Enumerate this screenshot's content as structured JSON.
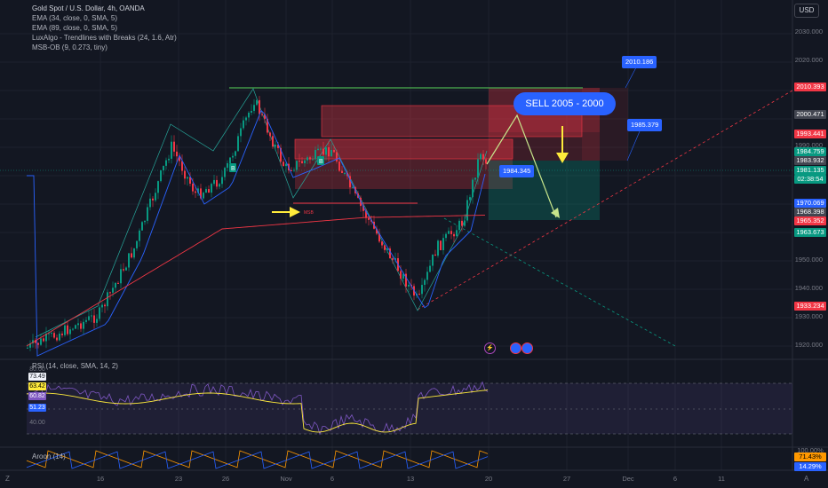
{
  "legend": {
    "title": "Gold Spot / U.S. Dollar, 4h, OANDA",
    "lines": [
      "EMA (34, close, 0, SMA, 5)",
      "EMA (89, close, 0, SMA, 5)",
      "LuxAlgo - Trendlines with Breaks (24, 1.6, Atr)",
      "MSB-OB (9, 0.273, tiny)"
    ]
  },
  "currency_button": "USD",
  "price_axis": {
    "labels": [
      "2030.000",
      "2020.000",
      "1990.000",
      "1950.000",
      "1940.000",
      "1930.000",
      "1920.000"
    ],
    "tags": [
      {
        "text": "2010.393",
        "color": "#f23645"
      },
      {
        "text": "2000.471",
        "color": "#434651"
      },
      {
        "text": "1993.441",
        "color": "#f23645"
      },
      {
        "text": "1984.759",
        "color": "#089981"
      },
      {
        "text": "1983.932",
        "color": "#434651"
      },
      {
        "text": "1981.135",
        "color": "#089981"
      },
      {
        "text": "02:38:54",
        "color": "#089981"
      },
      {
        "text": "1970.069",
        "color": "#2962ff"
      },
      {
        "text": "1968.398",
        "color": "#434651"
      },
      {
        "text": "1965.352",
        "color": "#f23645"
      },
      {
        "text": "1963.673",
        "color": "#089981"
      },
      {
        "text": "1933.234",
        "color": "#f23645"
      }
    ]
  },
  "annotations": {
    "sell_text": "SELL 2005 - 2000",
    "callouts": [
      "2010.186",
      "1985.379",
      "1984.345"
    ],
    "markers": [
      "B",
      "B",
      "MSB"
    ]
  },
  "rsi": {
    "label": "RSI (14, close, SMA, 14, 2)",
    "tags": [
      {
        "text": "73.49",
        "color": "#ffffff",
        "bg": "#f0f3fa"
      },
      {
        "text": "63.42",
        "color": "#000000",
        "bg": "#ffeb3b"
      },
      {
        "text": "60.82",
        "color": "#ffffff",
        "bg": "#7e57c2"
      },
      {
        "text": "51.23",
        "color": "#ffffff",
        "bg": "#2962ff"
      }
    ],
    "level_label": "40.00",
    "top_label": "80.00"
  },
  "aroon": {
    "label": "Aroon (14)",
    "tags": [
      {
        "text": "71.43%",
        "color": "#000",
        "bg": "#ff9800"
      },
      {
        "text": "14.29%",
        "color": "#fff",
        "bg": "#2962ff"
      }
    ],
    "top_label": "100.00%"
  },
  "time_axis": [
    "16",
    "23",
    "26",
    "Nov",
    "6",
    "13",
    "20",
    "27",
    "Dec",
    "6",
    "11"
  ],
  "chart_data": {
    "type": "candlestick",
    "symbol": "Gold Spot / U.S. Dollar",
    "timeframe": "4h",
    "ylim": [
      1915,
      2035
    ],
    "colors": {
      "up": "#089981",
      "down": "#f23645",
      "ema34": "#2962ff",
      "ema89": "#f23645"
    }
  }
}
